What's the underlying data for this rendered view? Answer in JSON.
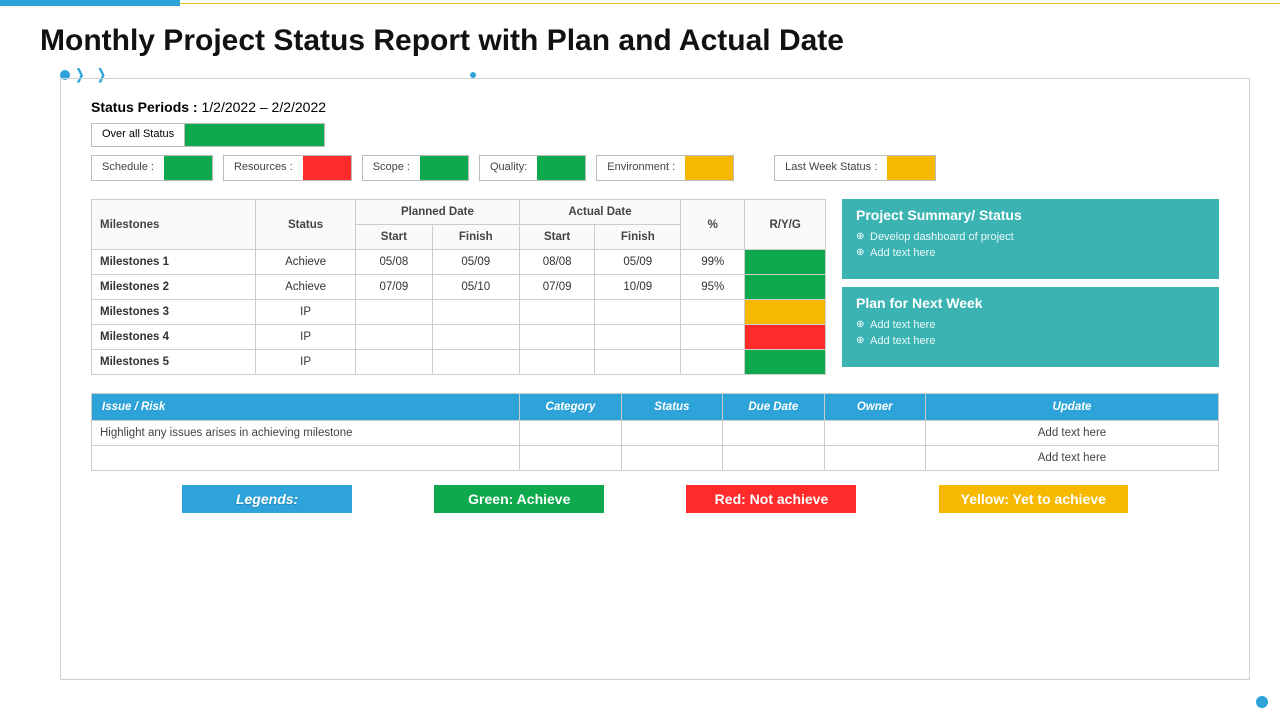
{
  "header": {
    "title": "Monthly Project Status Report with Plan and Actual Date"
  },
  "status_periods": {
    "label": "Status Periods :",
    "value": "1/2/2022 – 2/2/2022"
  },
  "overall": {
    "label": "Over all Status",
    "color": "#0ea94d"
  },
  "chips": [
    {
      "label": "Schedule :",
      "color": "#0ea94d"
    },
    {
      "label": "Resources :",
      "color": "#ff2a2a"
    },
    {
      "label": "Scope :",
      "color": "#0ea94d"
    },
    {
      "label": "Quality:",
      "color": "#0ea94d"
    },
    {
      "label": "Environment :",
      "color": "#f6b800"
    }
  ],
  "last_week": {
    "label": "Last Week Status :",
    "color": "#f6b800"
  },
  "table": {
    "headers": {
      "milestones": "Milestones",
      "status": "Status",
      "planned": "Planned Date",
      "actual": "Actual Date",
      "start": "Start",
      "finish": "Finish",
      "pct": "%",
      "ryg": "R/Y/G"
    },
    "rows": [
      {
        "name": "Milestones 1",
        "status": "Achieve",
        "ps": "05/08",
        "pf": "05/09",
        "as": "08/08",
        "af": "05/09",
        "pct": "99%",
        "ryg": "#0ea94d"
      },
      {
        "name": "Milestones 2",
        "status": "Achieve",
        "ps": "07/09",
        "pf": "05/10",
        "as": "07/09",
        "af": "10/09",
        "pct": "95%",
        "ryg": "#0ea94d"
      },
      {
        "name": "Milestones 3",
        "status": "IP",
        "ps": "",
        "pf": "",
        "as": "",
        "af": "",
        "pct": "",
        "ryg": "#f6b800"
      },
      {
        "name": "Milestones 4",
        "status": "IP",
        "ps": "",
        "pf": "",
        "as": "",
        "af": "",
        "pct": "",
        "ryg": "#ff2a2a"
      },
      {
        "name": "Milestones 5",
        "status": "IP",
        "ps": "",
        "pf": "",
        "as": "",
        "af": "",
        "pct": "",
        "ryg": "#0ea94d"
      }
    ]
  },
  "side": {
    "summary": {
      "title": "Project  Summary/ Status",
      "items": [
        "Develop  dashboard  of project",
        "Add text here"
      ]
    },
    "plan": {
      "title": "Plan for Next Week",
      "items": [
        "Add text here",
        "Add text here"
      ]
    }
  },
  "risk": {
    "headers": {
      "issue": "Issue / Risk",
      "category": "Category",
      "status": "Status",
      "due": "Due Date",
      "owner": "Owner",
      "update": "Update"
    },
    "rows": [
      {
        "issue": "Highlight any issues arises in achieving milestone",
        "category": "",
        "status": "",
        "due": "",
        "owner": "",
        "update": "Add text here"
      },
      {
        "issue": "",
        "category": "",
        "status": "",
        "due": "",
        "owner": "",
        "update": "Add text here"
      }
    ]
  },
  "legends": {
    "title": "Legends:",
    "green": "Green: Achieve",
    "red": "Red: Not achieve",
    "yellow": "Yellow: Yet to achieve"
  }
}
